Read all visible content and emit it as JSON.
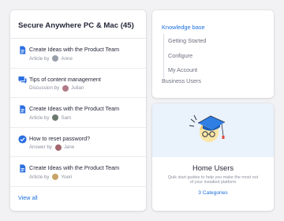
{
  "left_card": {
    "title": "Secure Anywhere PC & Mac (45)",
    "items": [
      {
        "icon": "document-icon",
        "title": "Create Ideas with the Product Team",
        "meta_label": "Article by",
        "author": "Anne",
        "avatar_color": "#9aa0aa"
      },
      {
        "icon": "discussion-icon",
        "title": "Tips of content management",
        "meta_label": "Discussion by",
        "author": "Julian",
        "avatar_color": "#b07a88"
      },
      {
        "icon": "document-icon",
        "title": "Create Ideas with the Product Team",
        "meta_label": "Article by",
        "author": "Sam",
        "avatar_color": "#6b7a6e"
      },
      {
        "icon": "answered-check-icon",
        "title": "How to reset password?",
        "meta_label": "Answer by",
        "author": "Jane",
        "avatar_color": "#a3666e"
      },
      {
        "icon": "document-icon",
        "title": "Create Ideas with the Product Team",
        "meta_label": "Article by",
        "author": "Yoeri",
        "avatar_color": "#c9a46a"
      }
    ],
    "view_all": "View all"
  },
  "kb_card": {
    "title": "Knowledge base",
    "sub_items": [
      "Getting Started",
      "Configure",
      "My Account"
    ],
    "other": "Business Users"
  },
  "home_card": {
    "title": "Home Users",
    "description_line1": "Quik start guides to help you make the most out",
    "description_line2": "of your installed platform",
    "link": "3 Categories"
  },
  "colors": {
    "accent": "#1b6fe0",
    "text_dark": "#26283a",
    "text_muted": "#8d90a0",
    "illustration_bg": "#eaf2fc"
  }
}
